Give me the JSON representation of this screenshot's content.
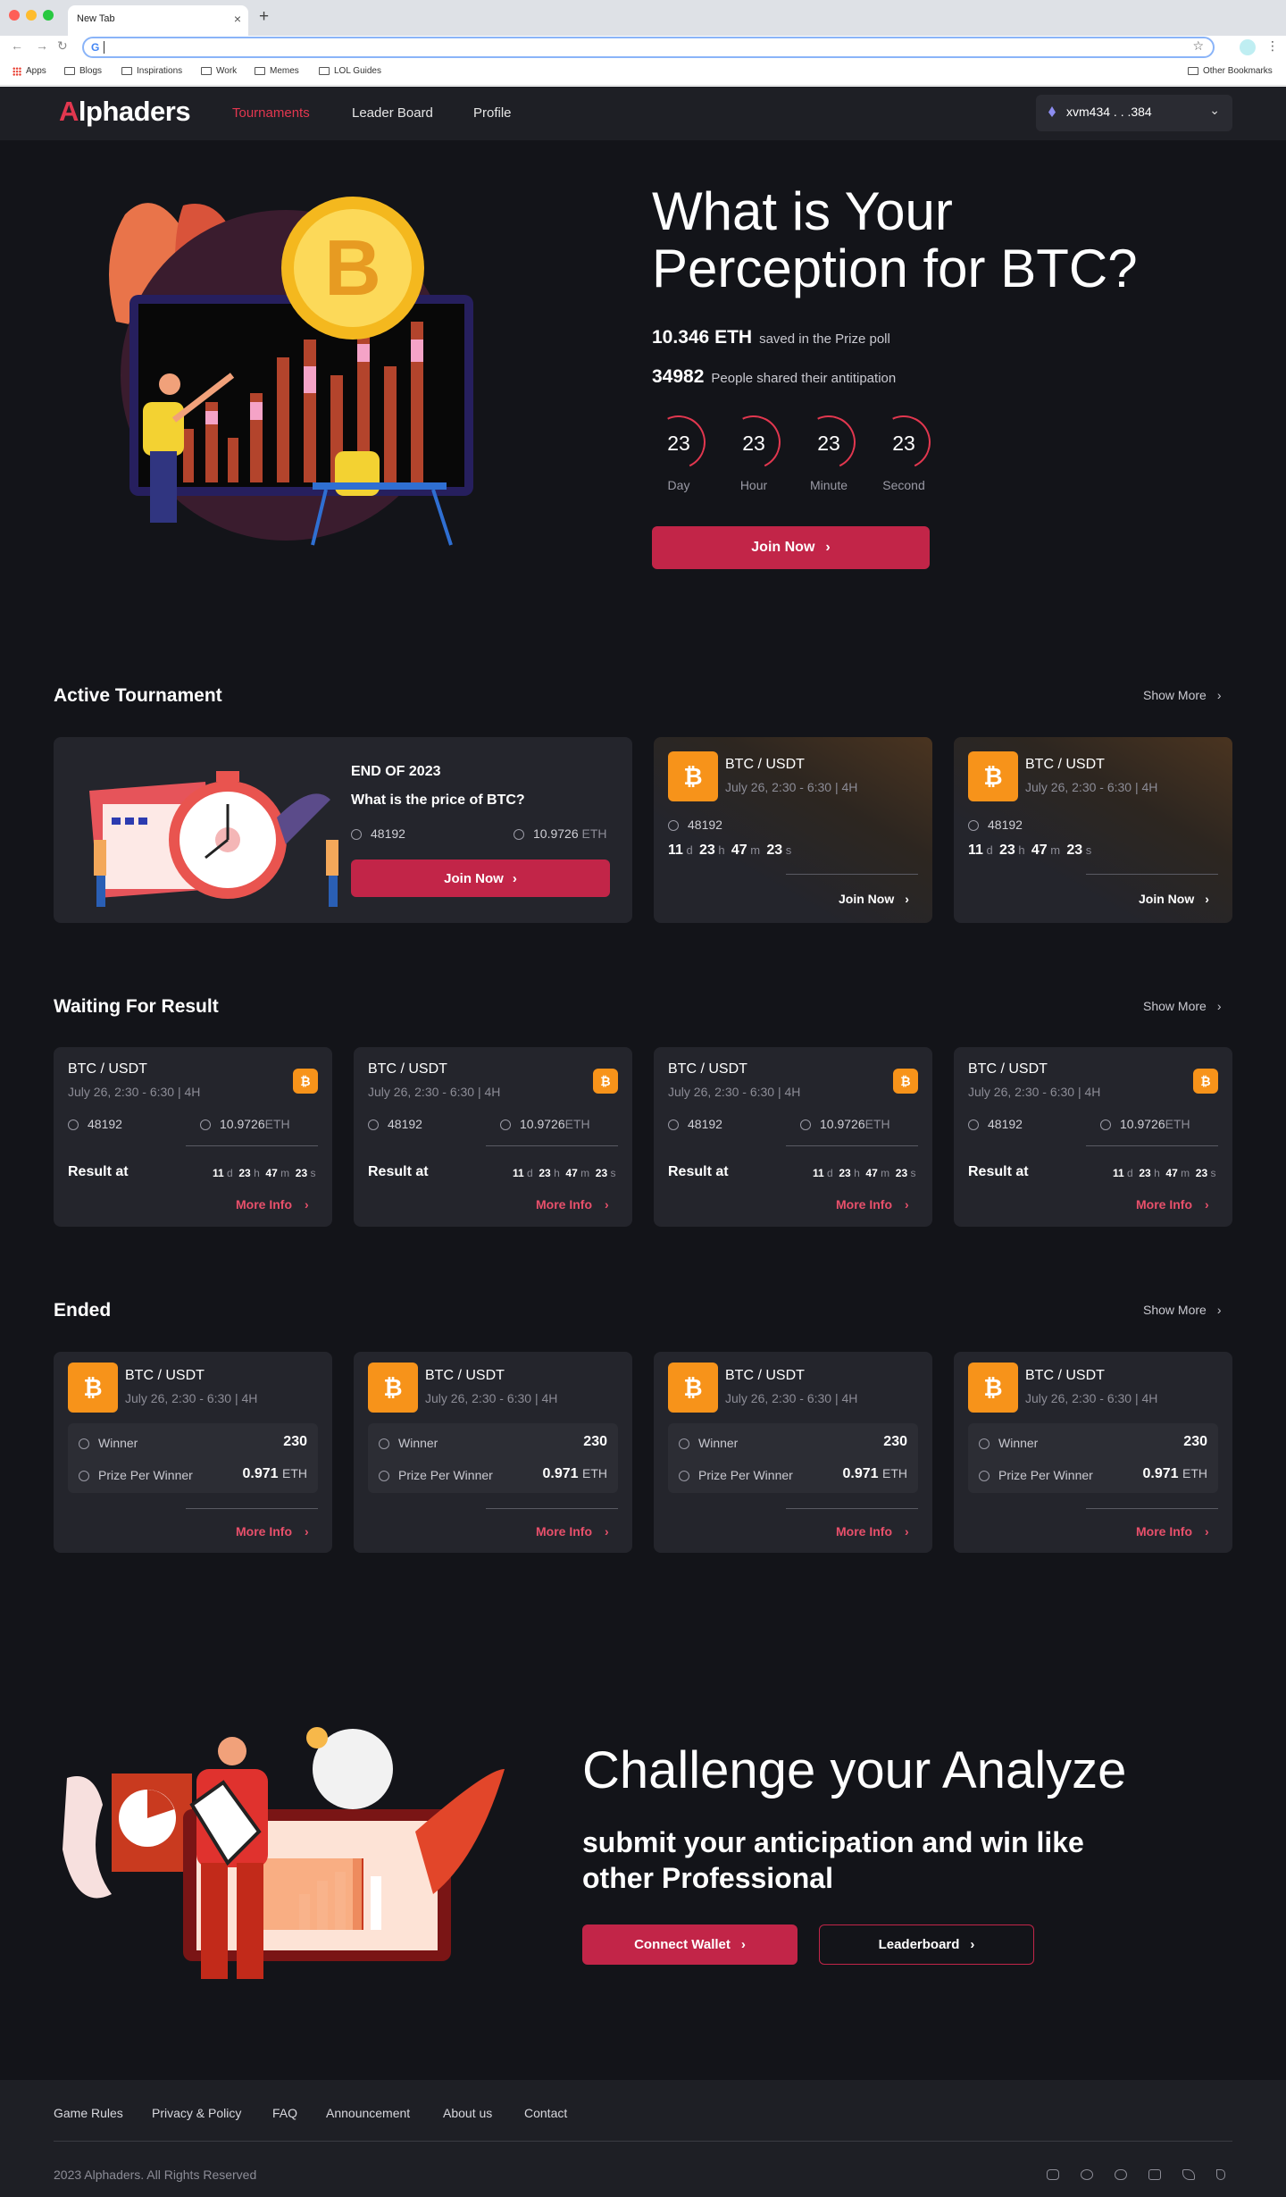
{
  "browser": {
    "tab_title": "New Tab",
    "bookmarks": [
      "Apps",
      "Blogs",
      "Inspirations",
      "Work",
      "Memes",
      "LOL Guides"
    ],
    "other_bookmarks": "Other Bookmarks"
  },
  "nav": {
    "logo_prefix": "A",
    "logo_rest": "lphaders",
    "links": [
      "Tournaments",
      "Leader Board",
      "Profile"
    ],
    "wallet": "xvm434 . . .384"
  },
  "hero": {
    "title": "What is Your Perception for BTC?",
    "eth_value": "10.346 ETH",
    "eth_text": "saved in the Prize poll",
    "people_value": "34982",
    "people_text": "People shared their antitipation",
    "countdown": [
      {
        "value": "23",
        "label": "Day"
      },
      {
        "value": "23",
        "label": "Hour"
      },
      {
        "value": "23",
        "label": "Minute"
      },
      {
        "value": "23",
        "label": "Second"
      }
    ],
    "cta": "Join Now"
  },
  "active": {
    "title": "Active Tournament",
    "show_more": "Show More",
    "featured": {
      "heading": "END OF 2023",
      "question": "What is the price of BTC?",
      "players": "48192",
      "prize": "10.9726",
      "prize_unit": "ETH",
      "cta": "Join Now"
    },
    "cards": [
      {
        "pair": "BTC / USDT",
        "date": "July 26, 2:30 - 6:30",
        "tf": "4H",
        "players": "48192",
        "d": "11",
        "h": "23",
        "m": "47",
        "s": "23",
        "cta": "Join Now"
      },
      {
        "pair": "BTC / USDT",
        "date": "July 26, 2:30 - 6:30",
        "tf": "4H",
        "players": "48192",
        "d": "11",
        "h": "23",
        "m": "47",
        "s": "23",
        "cta": "Join Now"
      }
    ]
  },
  "waiting": {
    "title": "Waiting For Result",
    "show_more": "Show More",
    "cards": [
      {
        "pair": "BTC / USDT",
        "date": "July 26, 2:30 - 6:30",
        "tf": "4H",
        "players": "48192",
        "prize": "10.9726",
        "unit": "ETH",
        "result_label": "Result at",
        "d": "11",
        "h": "23",
        "m": "47",
        "s": "23",
        "cta": "More Info"
      },
      {
        "pair": "BTC / USDT",
        "date": "July 26, 2:30 - 6:30",
        "tf": "4H",
        "players": "48192",
        "prize": "10.9726",
        "unit": "ETH",
        "result_label": "Result at",
        "d": "11",
        "h": "23",
        "m": "47",
        "s": "23",
        "cta": "More Info"
      },
      {
        "pair": "BTC / USDT",
        "date": "July 26, 2:30 - 6:30",
        "tf": "4H",
        "players": "48192",
        "prize": "10.9726",
        "unit": "ETH",
        "result_label": "Result at",
        "d": "11",
        "h": "23",
        "m": "47",
        "s": "23",
        "cta": "More Info"
      },
      {
        "pair": "BTC / USDT",
        "date": "July 26, 2:30 - 6:30",
        "tf": "4H",
        "players": "48192",
        "prize": "10.9726",
        "unit": "ETH",
        "result_label": "Result at",
        "d": "11",
        "h": "23",
        "m": "47",
        "s": "23",
        "cta": "More Info"
      }
    ]
  },
  "ended": {
    "title": "Ended",
    "show_more": "Show More",
    "cards": [
      {
        "pair": "BTC / USDT",
        "date": "July 26, 2:30 - 6:30",
        "tf": "4H",
        "winner_label": "Winner",
        "winners": "230",
        "prize_label": "Prize Per Winner",
        "prize": "0.971",
        "unit": "ETH",
        "cta": "More Info"
      },
      {
        "pair": "BTC / USDT",
        "date": "July 26, 2:30 - 6:30",
        "tf": "4H",
        "winner_label": "Winner",
        "winners": "230",
        "prize_label": "Prize Per Winner",
        "prize": "0.971",
        "unit": "ETH",
        "cta": "More Info"
      },
      {
        "pair": "BTC / USDT",
        "date": "July 26, 2:30 - 6:30",
        "tf": "4H",
        "winner_label": "Winner",
        "winners": "230",
        "prize_label": "Prize Per Winner",
        "prize": "0.971",
        "unit": "ETH",
        "cta": "More Info"
      },
      {
        "pair": "BTC / USDT",
        "date": "July 26, 2:30 - 6:30",
        "tf": "4H",
        "winner_label": "Winner",
        "winners": "230",
        "prize_label": "Prize Per Winner",
        "prize": "0.971",
        "unit": "ETH",
        "cta": "More Info"
      }
    ]
  },
  "challenge": {
    "title": "Challenge your Analyze",
    "subtitle": "submit your anticipation and win like other Professional",
    "connect": "Connect Wallet",
    "leaderboard": "Leaderboard"
  },
  "footer": {
    "links": [
      "Game Rules",
      "Privacy & Policy",
      "FAQ",
      "Announcement",
      "About us",
      "Contact"
    ],
    "copyright": "2023 Alphaders. All Rights Reserved",
    "socials": [
      "instagram-icon",
      "telegram-icon",
      "discord-icon",
      "youtube-icon",
      "twitter-icon",
      "tiktok-icon"
    ]
  },
  "colors": {
    "accent": "#c22548",
    "accent_text": "#e2374f",
    "btc": "#f7931a",
    "bg": "#131419",
    "card": "#24252c"
  }
}
